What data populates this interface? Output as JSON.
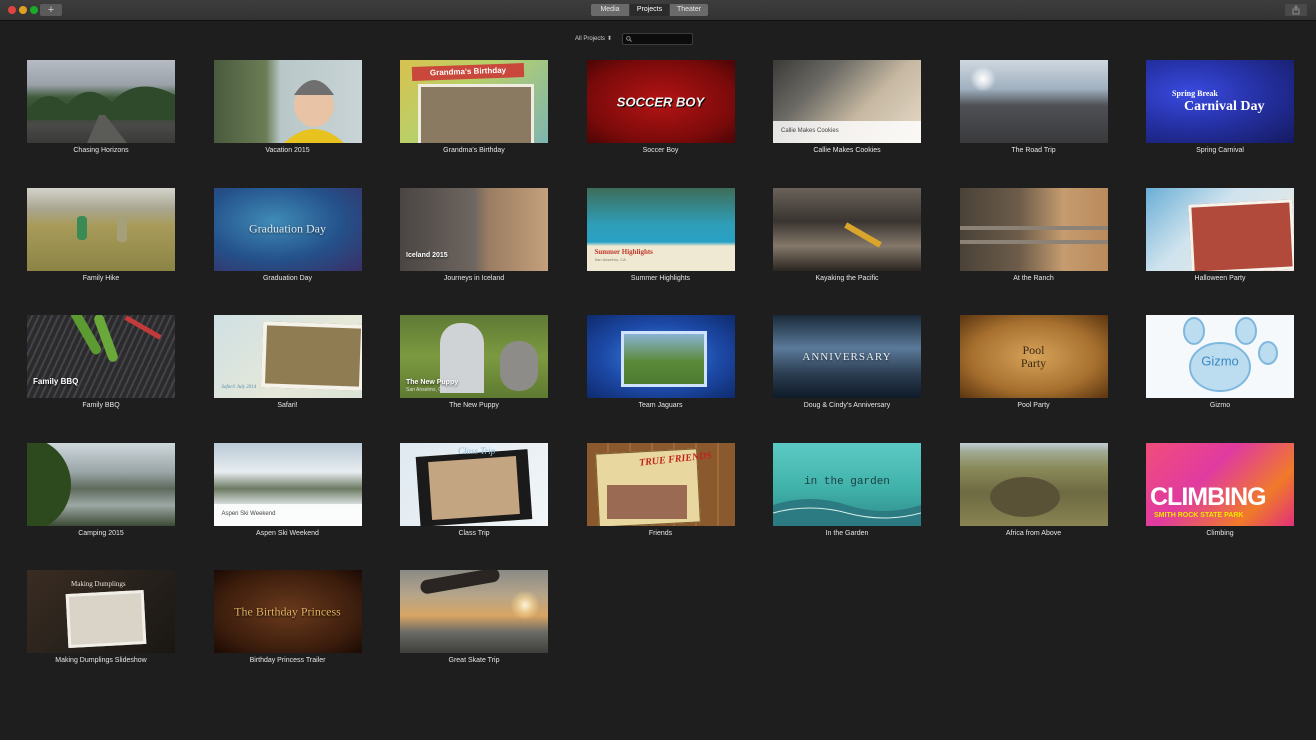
{
  "toolbar": {
    "add_label": "+",
    "tabs": [
      {
        "label": "Media",
        "active": false
      },
      {
        "label": "Projects",
        "active": true
      },
      {
        "label": "Theater",
        "active": false
      }
    ]
  },
  "filter": {
    "selected": "All Projects",
    "search_value": ""
  },
  "projects": [
    {
      "title": "Chasing Horizons",
      "overlay": ""
    },
    {
      "title": "Vacation 2015",
      "overlay": ""
    },
    {
      "title": "Grandma's Birthday",
      "overlay": "Grandma's Birthday"
    },
    {
      "title": "Soccer Boy",
      "overlay": "SOCCER BOY"
    },
    {
      "title": "Callie Makes Cookies",
      "overlay": "Callie Makes Cookies"
    },
    {
      "title": "The Road Trip",
      "overlay": ""
    },
    {
      "title": "Spring Carnival",
      "overlay": "Carnival Day",
      "overlay_sub": "Spring Break"
    },
    {
      "title": "Family Hike",
      "overlay": ""
    },
    {
      "title": "Graduation Day",
      "overlay": "Graduation Day"
    },
    {
      "title": "Journeys in Iceland",
      "overlay": "Iceland 2015"
    },
    {
      "title": "Summer Highlights",
      "overlay": "Summer Highlights",
      "overlay_sub": "San Anselmo, CA"
    },
    {
      "title": "Kayaking the Pacific",
      "overlay": ""
    },
    {
      "title": "At the Ranch",
      "overlay": ""
    },
    {
      "title": "Halloween Party",
      "overlay": ""
    },
    {
      "title": "Family BBQ",
      "overlay": "Family BBQ"
    },
    {
      "title": "Safari!",
      "overlay": "Safari! July 2014"
    },
    {
      "title": "The New Puppy",
      "overlay": "The New Puppy",
      "overlay_sub": "San Anselmo, CA"
    },
    {
      "title": "Team Jaguars",
      "overlay": ""
    },
    {
      "title": "Doug & Cindy's Anniversary",
      "overlay": "ANNIVERSARY"
    },
    {
      "title": "Pool Party",
      "overlay": "Pool Party"
    },
    {
      "title": "Gizmo",
      "overlay": "Gizmo"
    },
    {
      "title": "Camping 2015",
      "overlay": ""
    },
    {
      "title": "Aspen Ski Weekend",
      "overlay": "Aspen Ski Weekend"
    },
    {
      "title": "Class Trip",
      "overlay": "Class Trip"
    },
    {
      "title": "Friends",
      "overlay": "TRUE FRIENDS"
    },
    {
      "title": "In the Garden",
      "overlay": "in the garden"
    },
    {
      "title": "Africa from Above",
      "overlay": ""
    },
    {
      "title": "Climbing",
      "overlay": "CLIMBING",
      "overlay_sub": "SMITH ROCK STATE PARK"
    },
    {
      "title": "Making Dumplings Slideshow",
      "overlay": "Making Dumplings"
    },
    {
      "title": "Birthday Princess Trailer",
      "overlay": "The Birthday Princess"
    },
    {
      "title": "Great Skate Trip",
      "overlay": ""
    }
  ],
  "colors": {
    "background": "#1e1e1e",
    "titlebar": "#363636",
    "active_tab": "#2b2b2b",
    "label_text": "#e6e6e6"
  }
}
